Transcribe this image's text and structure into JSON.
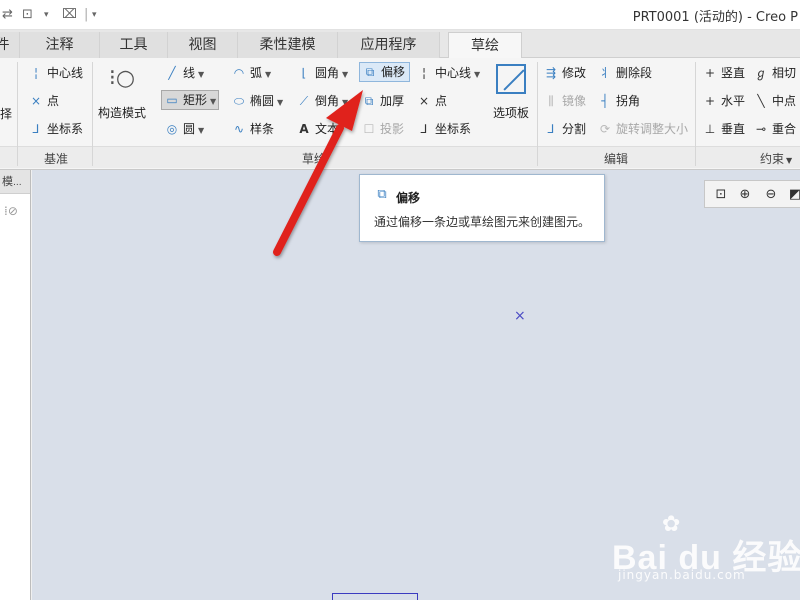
{
  "window": {
    "title": "PRT0001 (活动的) - Creo P"
  },
  "quick_access": {
    "item1": "⇄",
    "item2": "▾",
    "item3": "⌧",
    "item4": "▾"
  },
  "tabs": [
    {
      "label": "件"
    },
    {
      "label": "注释"
    },
    {
      "label": "工具"
    },
    {
      "label": "视图"
    },
    {
      "label": "柔性建模"
    },
    {
      "label": "应用程序"
    },
    {
      "label": "草绘"
    }
  ],
  "ribbon": {
    "datum": {
      "centerline": "中心线",
      "point": "点",
      "coord_sys": "坐标系",
      "left_cut": "择",
      "group_label": "基准"
    },
    "sketch": {
      "construction_mode": "构造模式",
      "line": "线",
      "rectangle": "矩形",
      "circle": "圆",
      "arc": "弧",
      "ellipse": "椭圆",
      "spline": "样条",
      "fillet": "圆角",
      "chamfer": "倒角",
      "text": "文本",
      "offset": "偏移",
      "thicken": "加厚",
      "project": "投影",
      "centerline": "中心线",
      "point": "点",
      "coord_sys": "坐标系",
      "palette": "选项板",
      "group_label": "草绘"
    },
    "edit": {
      "modify": "修改",
      "mirror": "镜像",
      "divide": "分割",
      "delete_segment": "删除段",
      "corner": "拐角",
      "rotate_resize": "旋转调整大小",
      "group_label": "编辑"
    },
    "constrain": {
      "vertical": "竖直",
      "horizontal": "水平",
      "perpendicular": "垂直",
      "tangent": "相切",
      "midpoint": "中点",
      "coincident": "重合",
      "group_label": "约束"
    }
  },
  "left_pane": {
    "tab_label": "模"
  },
  "tooltip": {
    "title": "偏移",
    "description": "通过偏移一条边或草绘图元来创建图元。"
  },
  "colors": {
    "accent": "#3a7fc1",
    "arrow": "#e0201c",
    "canvas": "#d9dfe9"
  },
  "watermark": {
    "logo": "Bai du 经验",
    "sub": "jingyan.baidu.com"
  }
}
